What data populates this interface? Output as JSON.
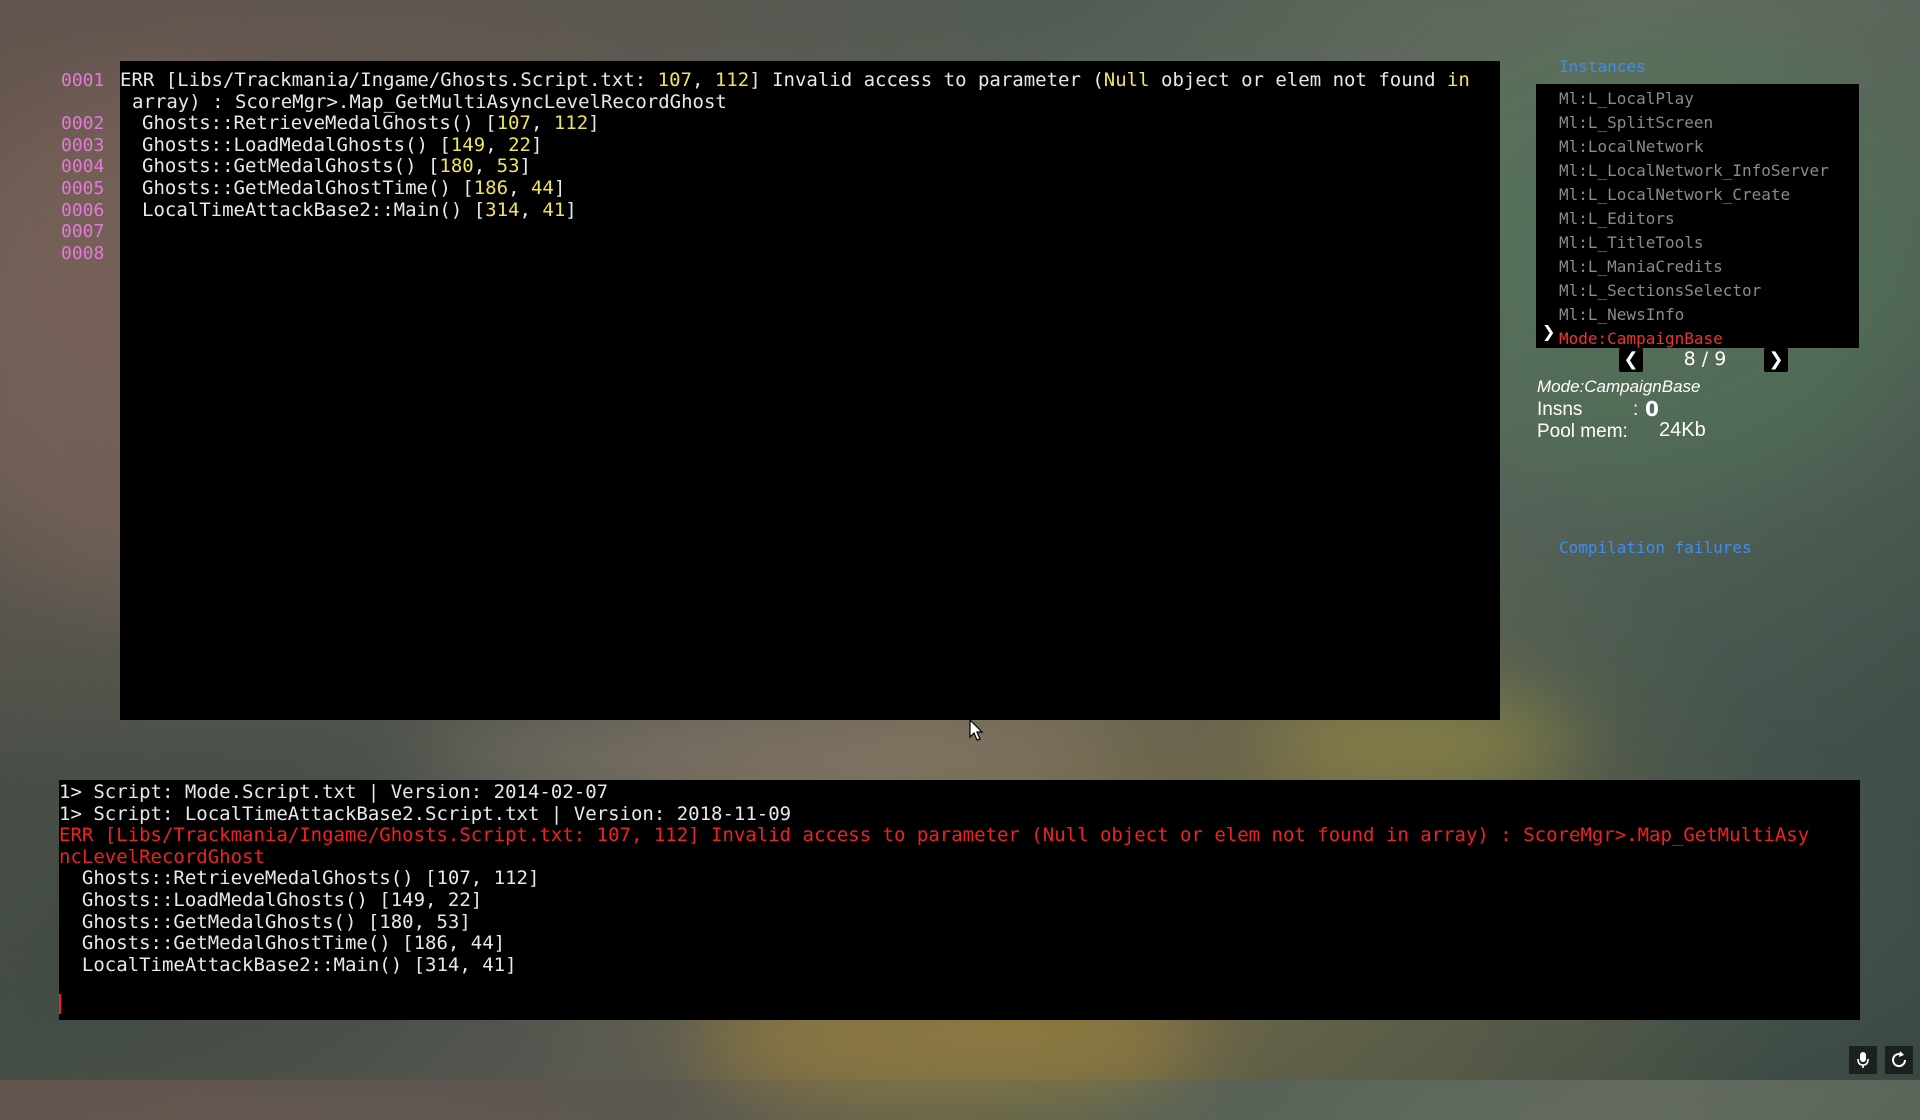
{
  "editor": {
    "lines": [
      {
        "n": "0001",
        "segments": [
          {
            "t": "ERR [Libs/Trackmania/Ingame/Ghosts.Script.txt: ",
            "c": "w"
          },
          {
            "t": "107",
            "c": "y"
          },
          {
            "t": ", ",
            "c": "w"
          },
          {
            "t": "112",
            "c": "y"
          },
          {
            "t": "] Invalid access to parameter (",
            "c": "w"
          },
          {
            "t": "Null",
            "c": "y"
          },
          {
            "t": " object or elem not found ",
            "c": "w"
          },
          {
            "t": "in",
            "c": "y"
          }
        ]
      },
      {
        "n": "",
        "segments": [
          {
            "t": "array) : ScoreMgr>.Map_GetMultiAsyncLevelRecordGhost",
            "c": "w"
          }
        ]
      },
      {
        "n": "0002",
        "segments": [
          {
            "t": "Ghosts::RetrieveMedalGhosts() [",
            "c": "w"
          },
          {
            "t": "107",
            "c": "y"
          },
          {
            "t": ", ",
            "c": "w"
          },
          {
            "t": "112",
            "c": "y"
          },
          {
            "t": "]",
            "c": "w"
          }
        ]
      },
      {
        "n": "0003",
        "segments": [
          {
            "t": "Ghosts::LoadMedalGhosts() [",
            "c": "w"
          },
          {
            "t": "149",
            "c": "y"
          },
          {
            "t": ", ",
            "c": "w"
          },
          {
            "t": "22",
            "c": "y"
          },
          {
            "t": "]",
            "c": "w"
          }
        ]
      },
      {
        "n": "0004",
        "segments": [
          {
            "t": "Ghosts::GetMedalGhosts() [",
            "c": "w"
          },
          {
            "t": "180",
            "c": "y"
          },
          {
            "t": ", ",
            "c": "w"
          },
          {
            "t": "53",
            "c": "y"
          },
          {
            "t": "]",
            "c": "w"
          }
        ]
      },
      {
        "n": "0005",
        "segments": [
          {
            "t": "Ghosts::GetMedalGhostTime() [",
            "c": "w"
          },
          {
            "t": "186",
            "c": "y"
          },
          {
            "t": ", ",
            "c": "w"
          },
          {
            "t": "44",
            "c": "y"
          },
          {
            "t": "]",
            "c": "w"
          }
        ]
      },
      {
        "n": "0006",
        "segments": [
          {
            "t": "LocalTimeAttackBase2::Main() [",
            "c": "w"
          },
          {
            "t": "314",
            "c": "y"
          },
          {
            "t": ", ",
            "c": "w"
          },
          {
            "t": "41",
            "c": "y"
          },
          {
            "t": "]",
            "c": "w"
          }
        ]
      },
      {
        "n": "0007",
        "segments": []
      },
      {
        "n": "0008",
        "segments": []
      }
    ]
  },
  "instances": {
    "title": "Instances",
    "items": [
      "Ml:L_LocalPlay",
      "Ml:L_SplitScreen",
      "Ml:LocalNetwork",
      "Ml:L_LocalNetwork_InfoServer",
      "Ml:L_LocalNetwork_Create",
      "Ml:L_Editors",
      "Ml:L_TitleTools",
      "Ml:L_ManiaCredits",
      "Ml:L_SectionsSelector",
      "Ml:L_NewsInfo",
      "Mode:CampaignBase"
    ],
    "selected_index": 10,
    "selected_marker": "❯",
    "pager": {
      "prev": "❮",
      "next": "❯",
      "text": "8 / 9"
    },
    "mode_label": "Mode:CampaignBase",
    "insns_label": "Insns",
    "insns_colon": ":",
    "insns_value": "0",
    "pool_label": "Pool mem:",
    "pool_value": "24Kb",
    "compilation_failures": "Compilation failures"
  },
  "console": {
    "lines": [
      {
        "t": "1> Script: Mode.Script.txt | Version: 2014-02-07",
        "err": false
      },
      {
        "t": "1> Script: LocalTimeAttackBase2.Script.txt | Version: 2018-11-09",
        "err": false
      },
      {
        "t": "ERR [Libs/Trackmania/Ingame/Ghosts.Script.txt: 107, 112] Invalid access to parameter (Null object or elem not found in array) : ScoreMgr>.Map_GetMultiAsy",
        "err": true
      },
      {
        "t": "ncLevelRecordGhost",
        "err": true
      },
      {
        "t": "  Ghosts::RetrieveMedalGhosts() [107, 112]",
        "err": false
      },
      {
        "t": "  Ghosts::LoadMedalGhosts() [149, 22]",
        "err": false
      },
      {
        "t": "  Ghosts::GetMedalGhosts() [180, 53]",
        "err": false
      },
      {
        "t": "  Ghosts::GetMedalGhostTime() [186, 44]",
        "err": false
      },
      {
        "t": "  LocalTimeAttackBase2::Main() [314, 41]",
        "err": false
      }
    ]
  },
  "corner_icons": [
    "microphone-icon",
    "refresh-icon"
  ]
}
